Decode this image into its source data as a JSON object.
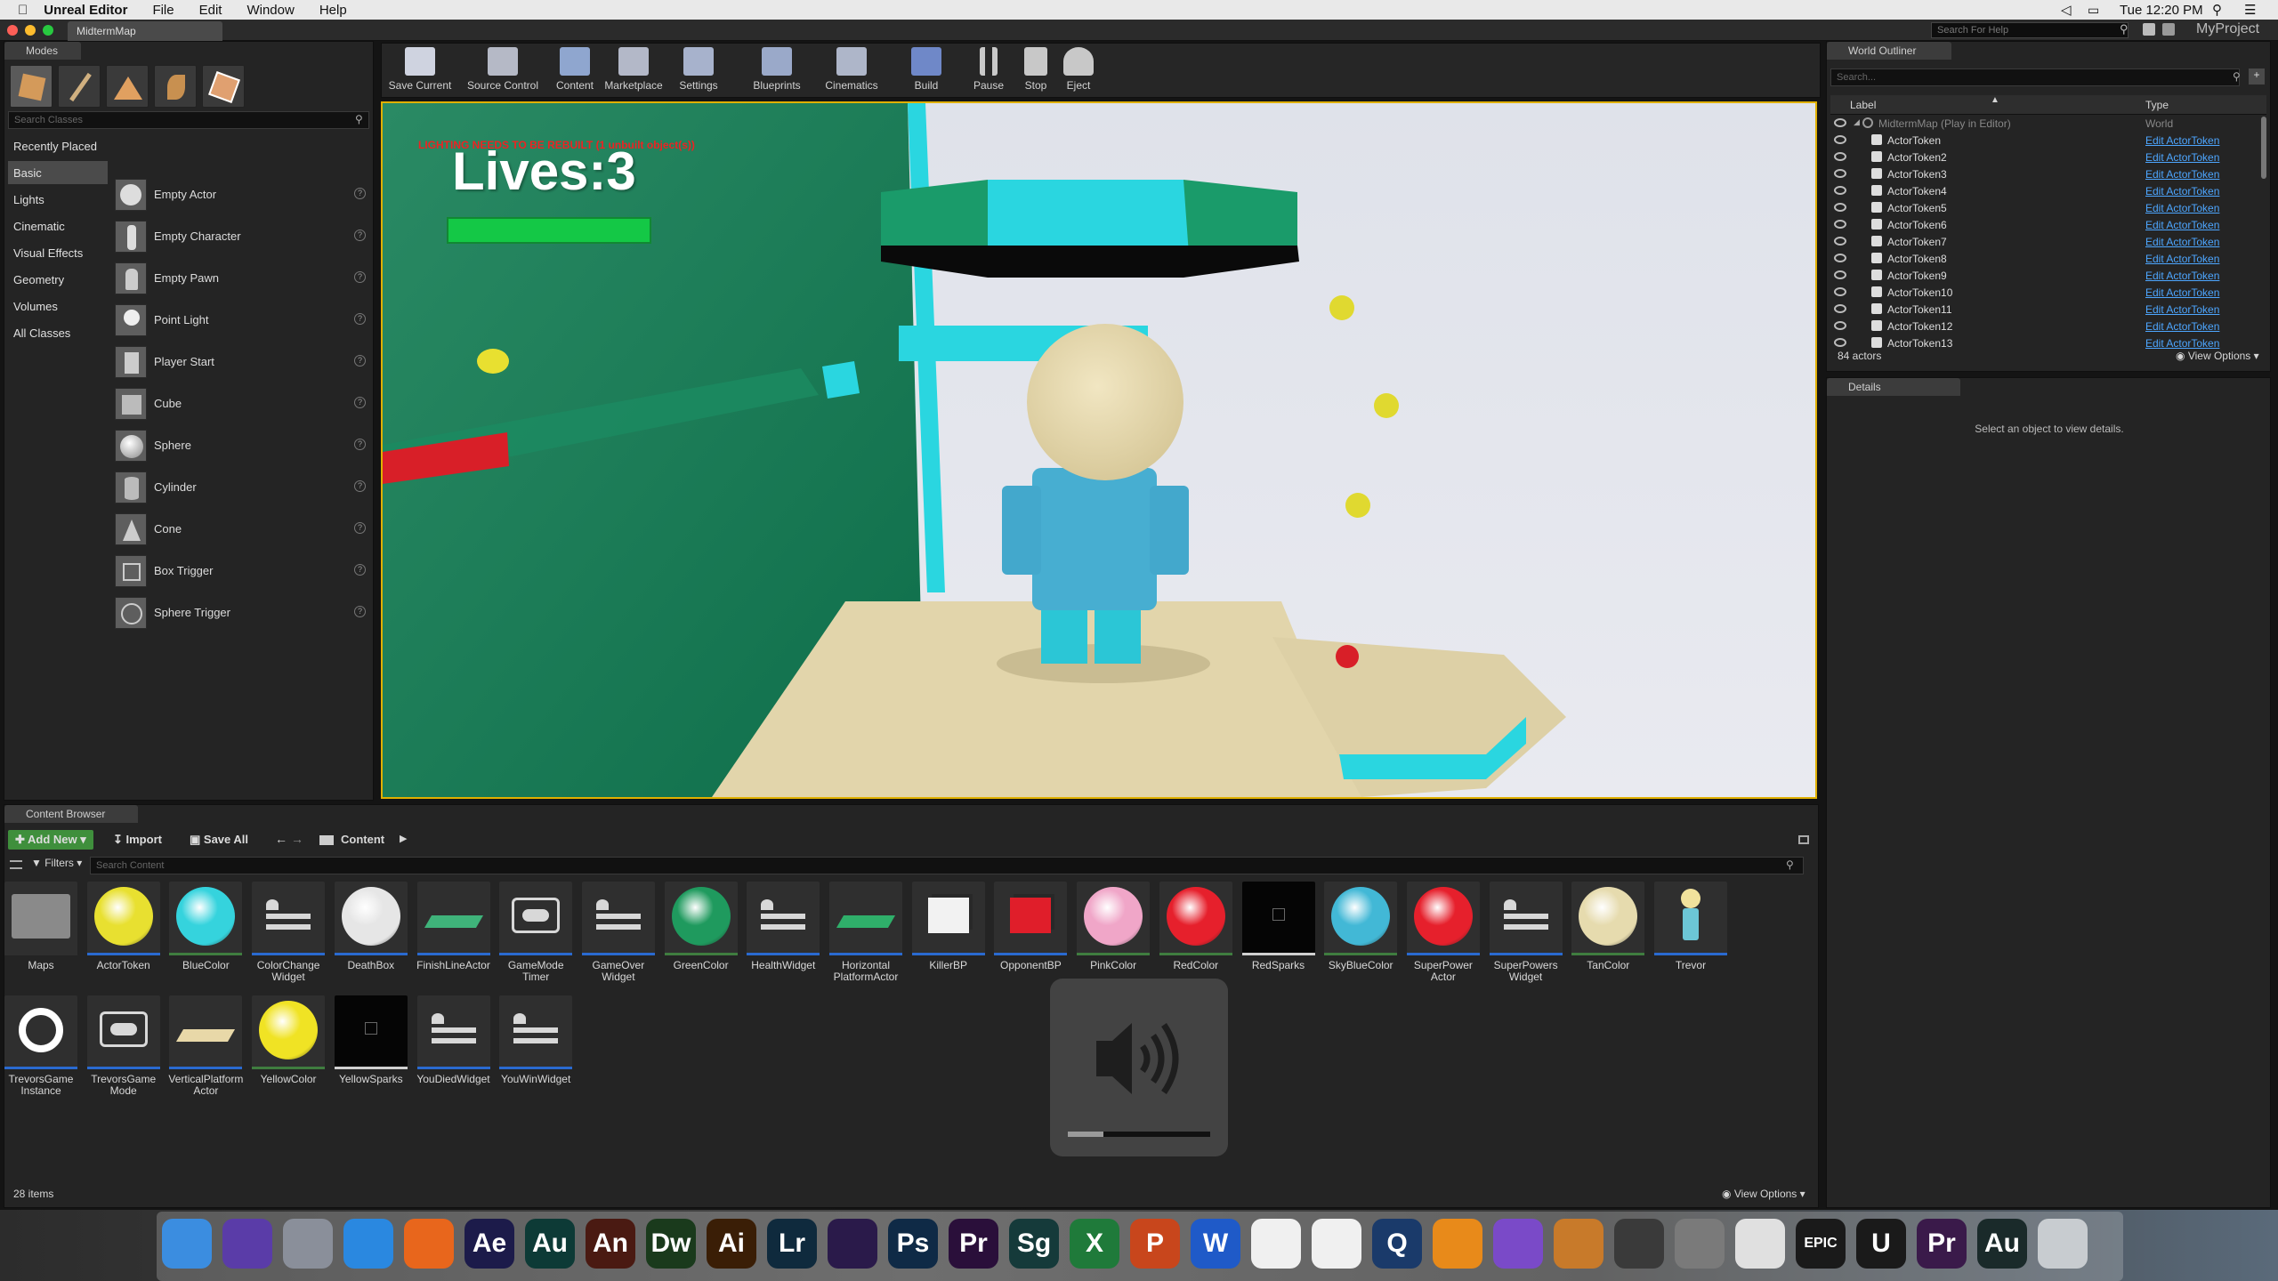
{
  "menubar": {
    "app": "Unreal Editor",
    "menus": [
      "File",
      "Edit",
      "Window",
      "Help"
    ],
    "clock": "Tue 12:20 PM"
  },
  "titlebar": {
    "map_tab": "MidtermMap",
    "help_search_placeholder": "Search For Help",
    "project": "MyProject"
  },
  "modes": {
    "tab": "Modes",
    "search_placeholder": "Search Classes",
    "categories": [
      "Recently Placed",
      "Basic",
      "Lights",
      "Cinematic",
      "Visual Effects",
      "Geometry",
      "Volumes",
      "All Classes"
    ],
    "selected_category": "Basic",
    "items": [
      "Empty Actor",
      "Empty Character",
      "Empty Pawn",
      "Point Light",
      "Player Start",
      "Cube",
      "Sphere",
      "Cylinder",
      "Cone",
      "Box Trigger",
      "Sphere Trigger"
    ],
    "help_glyph": "?"
  },
  "toolbar": {
    "buttons": [
      {
        "label": "Save Current",
        "icon": "save-icon",
        "color": "#cfd3e0"
      },
      {
        "label": "Source Control",
        "icon": "source-control-icon",
        "color": "#b5b9c6"
      },
      {
        "label": "Content",
        "icon": "content-icon",
        "color": "#8fa6cf"
      },
      {
        "label": "Marketplace",
        "icon": "marketplace-icon",
        "color": "#b3b8c8"
      },
      {
        "label": "Settings",
        "icon": "settings-icon",
        "color": "#a7b2cc"
      },
      {
        "label": "Blueprints",
        "icon": "blueprints-icon",
        "color": "#9aa9c9"
      },
      {
        "label": "Cinematics",
        "icon": "cinematics-icon",
        "color": "#aeb6c9"
      },
      {
        "label": "Build",
        "icon": "build-icon",
        "color": "#6f88c8"
      },
      {
        "label": "Pause",
        "icon": "pause-icon",
        "color": "#c8c8c8"
      },
      {
        "label": "Stop",
        "icon": "stop-icon",
        "color": "#c8c8c8"
      },
      {
        "label": "Eject",
        "icon": "eject-icon",
        "color": "#c8c8c8"
      }
    ]
  },
  "viewport": {
    "warning": "LIGHTING NEEDS TO BE REBUILT (1 unbuilt object(s))",
    "lives": "Lives:3",
    "health_fraction": 1.0
  },
  "outliner": {
    "tab": "World Outliner",
    "search_placeholder": "Search...",
    "col_label": "Label",
    "col_type": "Type",
    "world_row": {
      "label": "MidtermMap (Play in Editor)",
      "type": "World"
    },
    "rows": [
      {
        "label": "ActorToken",
        "type": "Edit ActorToken"
      },
      {
        "label": "ActorToken2",
        "type": "Edit ActorToken"
      },
      {
        "label": "ActorToken3",
        "type": "Edit ActorToken"
      },
      {
        "label": "ActorToken4",
        "type": "Edit ActorToken"
      },
      {
        "label": "ActorToken5",
        "type": "Edit ActorToken"
      },
      {
        "label": "ActorToken6",
        "type": "Edit ActorToken"
      },
      {
        "label": "ActorToken7",
        "type": "Edit ActorToken"
      },
      {
        "label": "ActorToken8",
        "type": "Edit ActorToken"
      },
      {
        "label": "ActorToken9",
        "type": "Edit ActorToken"
      },
      {
        "label": "ActorToken10",
        "type": "Edit ActorToken"
      },
      {
        "label": "ActorToken11",
        "type": "Edit ActorToken"
      },
      {
        "label": "ActorToken12",
        "type": "Edit ActorToken"
      },
      {
        "label": "ActorToken13",
        "type": "Edit ActorToken"
      }
    ],
    "count": "84 actors",
    "view_options": "View Options"
  },
  "details": {
    "tab": "Details",
    "empty": "Select an object to view details."
  },
  "content_browser": {
    "tab": "Content Browser",
    "add_new": "Add New",
    "import": "Import",
    "save_all": "Save All",
    "path": "Content",
    "filters": "Filters",
    "search_placeholder": "Search Content",
    "items_count": "28 items",
    "view_options": "View Options",
    "assets": [
      {
        "name": "Maps",
        "kind": "folder",
        "color": "#8a8a8a",
        "bar": "#2f2f2f"
      },
      {
        "name": "ActorToken",
        "kind": "sphere",
        "color": "#e8e030",
        "bar": "#2a6ad0"
      },
      {
        "name": "BlueColor",
        "kind": "sphere",
        "color": "#35d3dd",
        "bar": "#3f7d3f"
      },
      {
        "name": "ColorChange Widget",
        "kind": "widget",
        "color": "#d8d8d8",
        "bar": "#2a6ad0"
      },
      {
        "name": "DeathBox",
        "kind": "sphere",
        "color": "#e6e6e6",
        "bar": "#2a6ad0"
      },
      {
        "name": "FinishLineActor",
        "kind": "plate",
        "color": "#3fb37a",
        "bar": "#2a6ad0"
      },
      {
        "name": "GameMode Timer",
        "kind": "gamepad",
        "color": "#d8d8d8",
        "bar": "#2a6ad0"
      },
      {
        "name": "GameOver Widget",
        "kind": "widget",
        "color": "#d8d8d8",
        "bar": "#2a6ad0"
      },
      {
        "name": "GreenColor",
        "kind": "sphere",
        "color": "#1f9a5e",
        "bar": "#3f7d3f"
      },
      {
        "name": "HealthWidget",
        "kind": "widget",
        "color": "#d8d8d8",
        "bar": "#2a6ad0"
      },
      {
        "name": "Horizontal PlatformActor",
        "kind": "plate",
        "color": "#2faf6a",
        "bar": "#2a6ad0"
      },
      {
        "name": "KillerBP",
        "kind": "box",
        "color": "#f2f2f2",
        "bar": "#2a6ad0"
      },
      {
        "name": "OpponentBP",
        "kind": "box",
        "color": "#e01e2a",
        "bar": "#2a6ad0"
      },
      {
        "name": "PinkColor",
        "kind": "sphere",
        "color": "#f0a6c8",
        "bar": "#3f7d3f"
      },
      {
        "name": "RedColor",
        "kind": "sphere",
        "color": "#e6202c",
        "bar": "#3f7d3f"
      },
      {
        "name": "RedSparks",
        "kind": "particle",
        "color": "#050505",
        "bar": "#d0d0d0"
      },
      {
        "name": "SkyBlueColor",
        "kind": "sphere",
        "color": "#42b8d6",
        "bar": "#3f7d3f"
      },
      {
        "name": "SuperPower Actor",
        "kind": "sphere",
        "color": "#e6202c",
        "bar": "#2a6ad0"
      },
      {
        "name": "SuperPowers Widget",
        "kind": "widget",
        "color": "#d8d8d8",
        "bar": "#2a6ad0"
      },
      {
        "name": "TanColor",
        "kind": "sphere",
        "color": "#e6dbae",
        "bar": "#3f7d3f"
      },
      {
        "name": "Trevor",
        "kind": "figure",
        "color": "#f1e29c",
        "bar": "#2a6ad0"
      },
      {
        "name": "TrevorsGame Instance",
        "kind": "ring",
        "color": "#ffffff",
        "bar": "#2a6ad0"
      },
      {
        "name": "TrevorsGame Mode",
        "kind": "gamepad",
        "color": "#d8d8d8",
        "bar": "#2a6ad0"
      },
      {
        "name": "VerticalPlatform Actor",
        "kind": "plate",
        "color": "#e8d8a8",
        "bar": "#2a6ad0"
      },
      {
        "name": "YellowColor",
        "kind": "sphere",
        "color": "#f0e324",
        "bar": "#3f7d3f"
      },
      {
        "name": "YellowSparks",
        "kind": "particle",
        "color": "#050505",
        "bar": "#d0d0d0"
      },
      {
        "name": "YouDiedWidget",
        "kind": "widget",
        "color": "#d8d8d8",
        "bar": "#2a6ad0"
      },
      {
        "name": "YouWinWidget",
        "kind": "widget",
        "color": "#d8d8d8",
        "bar": "#2a6ad0"
      }
    ]
  },
  "volume_hud": {
    "level_fraction": 0.25
  },
  "dock": {
    "apps": [
      {
        "name": "finder-icon",
        "label": "",
        "color": "#3b8de0"
      },
      {
        "name": "siri-icon",
        "label": "",
        "color": "#5a3ca8"
      },
      {
        "name": "launchpad-icon",
        "label": "",
        "color": "#8a8f9a"
      },
      {
        "name": "safari-icon",
        "label": "",
        "color": "#2a88e0"
      },
      {
        "name": "firefox-icon",
        "label": "",
        "color": "#e8661c"
      },
      {
        "name": "after-effects-icon",
        "label": "Ae",
        "color": "#1c1b4a"
      },
      {
        "name": "audition-icon",
        "label": "Au",
        "color": "#0d3a36"
      },
      {
        "name": "animate-icon",
        "label": "An",
        "color": "#4a1a12"
      },
      {
        "name": "dreamweaver-icon",
        "label": "Dw",
        "color": "#1a3a1c"
      },
      {
        "name": "illustrator-icon",
        "label": "Ai",
        "color": "#3a1e06"
      },
      {
        "name": "lightroom-icon",
        "label": "Lr",
        "color": "#0f2a3d"
      },
      {
        "name": "media-encoder-icon",
        "label": "",
        "color": "#2a1a4a"
      },
      {
        "name": "photoshop-icon",
        "label": "Ps",
        "color": "#0f2a46"
      },
      {
        "name": "premiere-icon",
        "label": "Pr",
        "color": "#2a0f3a"
      },
      {
        "name": "spark-icon",
        "label": "Sg",
        "color": "#153a3a"
      },
      {
        "name": "excel-icon",
        "label": "X",
        "color": "#1f7a3a"
      },
      {
        "name": "powerpoint-icon",
        "label": "P",
        "color": "#c8461c"
      },
      {
        "name": "word-icon",
        "label": "W",
        "color": "#1f5ac8"
      },
      {
        "name": "itunes-icon",
        "label": "",
        "color": "#f0f0f0"
      },
      {
        "name": "photos-icon",
        "label": "",
        "color": "#f0f0f0"
      },
      {
        "name": "quicktime-icon",
        "label": "Q",
        "color": "#1a3a6a"
      },
      {
        "name": "vlc-icon",
        "label": "",
        "color": "#e88a1a"
      },
      {
        "name": "imovie-icon",
        "label": "",
        "color": "#7a4ac8"
      },
      {
        "name": "garageband-icon",
        "label": "",
        "color": "#c87a2a"
      },
      {
        "name": "final-cut-icon",
        "label": "",
        "color": "#3a3a3a"
      },
      {
        "name": "system-prefs-icon",
        "label": "",
        "color": "#7a7a7a"
      },
      {
        "name": "chrome-icon",
        "label": "",
        "color": "#e0e0e0"
      },
      {
        "name": "epic-games-icon",
        "label": "EPIC",
        "color": "#1a1a1a"
      },
      {
        "name": "unreal-icon",
        "label": "U",
        "color": "#1a1a1a"
      },
      {
        "name": "premiere-project-icon",
        "label": "Pr",
        "color": "#3a1a4a"
      },
      {
        "name": "audition-session-icon",
        "label": "Au",
        "color": "#1a2a2a"
      },
      {
        "name": "trash-icon",
        "label": "",
        "color": "#c8ccd0"
      }
    ]
  }
}
